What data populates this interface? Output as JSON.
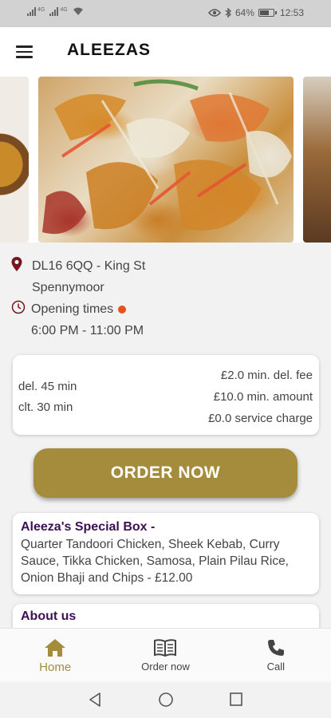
{
  "status_bar": {
    "signal1_label": "4G",
    "signal2_label": "4G",
    "battery_percent": "64%",
    "battery_level": 0.64,
    "time": "12:53",
    "icons": [
      "signal-icon",
      "signal-icon",
      "wifi-icon",
      "eye-icon",
      "bluetooth-icon",
      "battery-icon"
    ]
  },
  "app_bar": {
    "title": "ALEEZAS",
    "menu_icon": "menu-icon"
  },
  "restaurant": {
    "address_line1": "DL16 6QQ - King St",
    "address_line2": "Spennymoor",
    "opening_label": "Opening times",
    "opening_hours": "6:00 PM - 11:00 PM",
    "status_color": "#e8501c"
  },
  "delivery": {
    "delivery_time": "del. 45 min",
    "collection_time": "clt. 30 min",
    "min_delivery_fee": "£2.0 min. del. fee",
    "min_amount": "£10.0 min. amount",
    "service_charge": "£0.0 service charge"
  },
  "order_button": {
    "label": "ORDER NOW",
    "color": "#a48c3c"
  },
  "special": {
    "title": "Aleeza's Special Box -",
    "description": "Quarter Tandoori Chicken, Sheek Kebab, Curry Sauce, Tikka Chicken, Samosa, Plain Pilau Rice, Onion Bhaji and Chips - £12.00"
  },
  "about": {
    "title": "About us"
  },
  "bottom_nav": {
    "items": [
      {
        "label": "Home",
        "icon": "home-icon",
        "active": true
      },
      {
        "label": "Order now",
        "icon": "menu-book-icon",
        "active": false
      },
      {
        "label": "Call",
        "icon": "phone-icon",
        "active": false
      }
    ]
  },
  "theme": {
    "accent": "#a48c3c",
    "heading": "#3c1053",
    "pin": "#7a1520"
  }
}
